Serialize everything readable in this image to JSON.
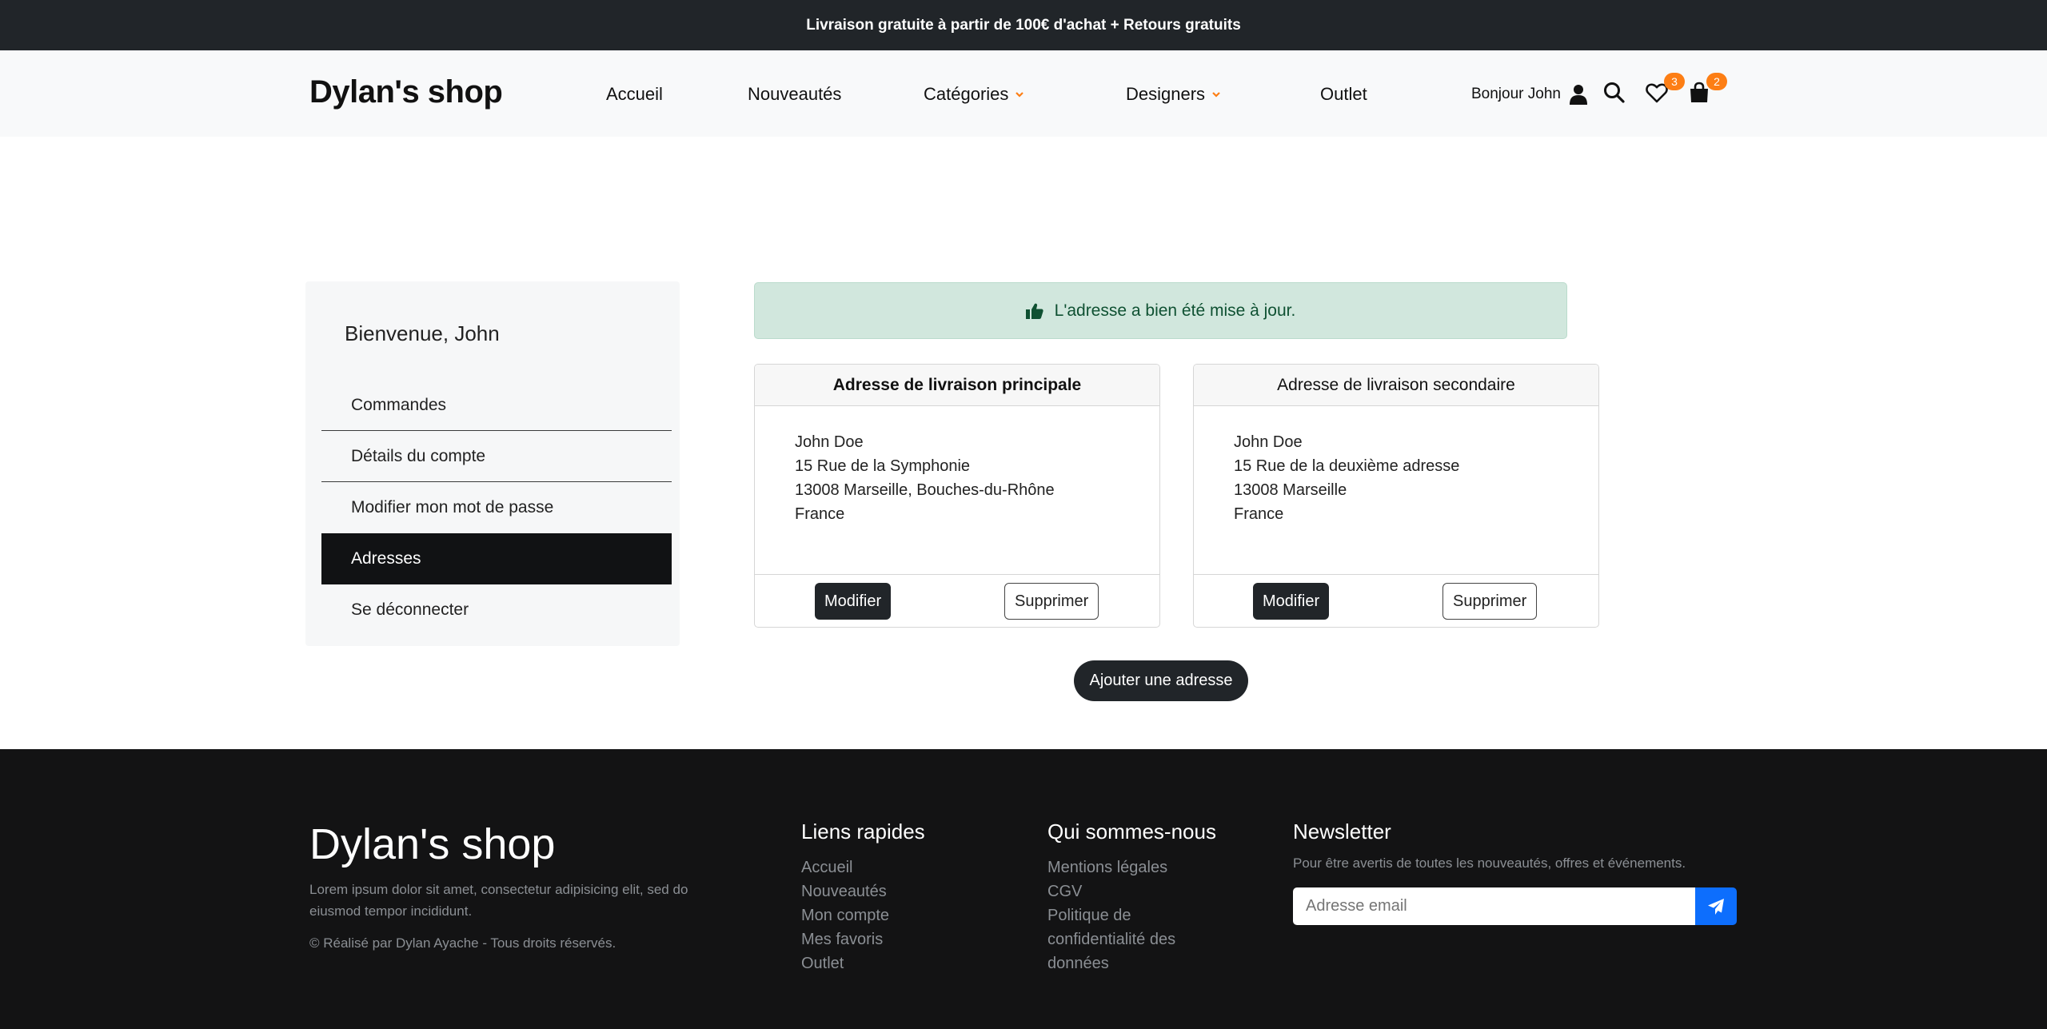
{
  "promo": {
    "text": "Livraison gratuite à partir de 100€ d'achat + Retours gratuits"
  },
  "header": {
    "brand": "Dylan's shop",
    "nav": [
      {
        "label": "Accueil"
      },
      {
        "label": "Nouveautés"
      },
      {
        "label": "Catégories",
        "dropdown": true
      },
      {
        "label": "Designers",
        "dropdown": true
      },
      {
        "label": "Outlet"
      }
    ],
    "greeting": "Bonjour John",
    "user_icon": "user-icon",
    "search_icon": "search-icon",
    "wishlist_icon": "heart-icon",
    "wishlist_count": "3",
    "cart_icon": "shopping-bag-icon",
    "cart_count": "2",
    "accent_color": "#fd7e14"
  },
  "sidebar": {
    "welcome": "Bienvenue, John",
    "items": [
      {
        "label": "Commandes"
      },
      {
        "label": "Détails du compte"
      },
      {
        "label": "Modifier mon mot de passe"
      },
      {
        "label": "Adresses",
        "active": true
      },
      {
        "label": "Se déconnecter"
      }
    ]
  },
  "alert": {
    "icon": "thumbs-up-icon",
    "text": "L'adresse a bien été mise à jour.",
    "color": "#d1e7dd"
  },
  "addresses": [
    {
      "title": "Adresse de livraison principale",
      "lines": [
        "John Doe",
        "15 Rue de la Symphonie",
        "13008 Marseille, Bouches-du-Rhône",
        "France"
      ],
      "edit_label": "Modifier",
      "delete_label": "Supprimer"
    },
    {
      "title": "Adresse de livraison secondaire",
      "lines": [
        "John Doe",
        "15 Rue de la deuxième adresse",
        "13008 Marseille",
        "France"
      ],
      "edit_label": "Modifier",
      "delete_label": "Supprimer"
    }
  ],
  "add_address_label": "Ajouter une adresse",
  "footer": {
    "brand": "Dylan's shop",
    "description": "Lorem ipsum dolor sit amet, consectetur adipisicing elit, sed do eiusmod tempor incididunt.",
    "copyright": "© Réalisé par Dylan Ayache - Tous droits réservés.",
    "quick_links": {
      "title": "Liens rapides",
      "links": [
        "Accueil",
        "Nouveautés",
        "Mon compte",
        "Mes favoris",
        "Outlet"
      ]
    },
    "about": {
      "title": "Qui sommes-nous",
      "links": [
        "Mentions légales",
        "CGV",
        "Politique de confidentialité des données"
      ]
    },
    "newsletter": {
      "title": "Newsletter",
      "text": "Pour être avertis de toutes les nouveautés, offres et événements.",
      "placeholder": "Adresse email",
      "submit_icon": "paper-plane-icon",
      "button_color": "#0d6efd"
    }
  }
}
